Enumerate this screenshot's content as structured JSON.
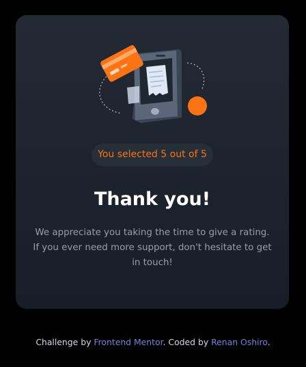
{
  "card": {
    "selection_text": "You selected 5 out of 5",
    "title": "Thank you!",
    "message": "We appreciate you taking the time to give a rating. If you ever need more support, don't hesitate to get in touch!"
  },
  "illustration": {
    "icons": [
      "credit-card-icon",
      "phone-icon",
      "receipt-icon",
      "orange-dot-icon"
    ]
  },
  "footer": {
    "prefix": "Challenge by ",
    "challenge_link": "Frontend Mentor",
    "middle": ". Coded by ",
    "author_link": "Renan Oshiro",
    "suffix": "."
  },
  "colors": {
    "accent": "#fb7413",
    "link": "#7b7fe0",
    "card_bg": "#1e252f",
    "page_bg": "#000000"
  }
}
